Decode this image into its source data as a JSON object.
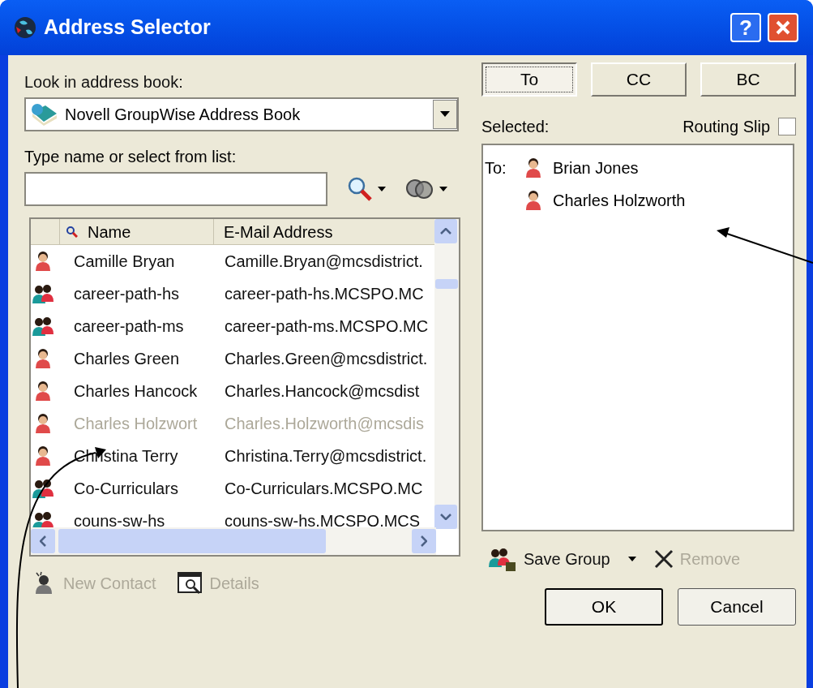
{
  "window": {
    "title": "Address Selector",
    "help_button": "?"
  },
  "address_book": {
    "label": "Look in address book:",
    "value": "Novell GroupWise Address Book"
  },
  "recipient_buttons": [
    {
      "label": "To",
      "selected": true
    },
    {
      "label": "CC",
      "selected": false
    },
    {
      "label": "BC",
      "selected": false
    }
  ],
  "search": {
    "label": "Type name or select from list:"
  },
  "list": {
    "columns": [
      "Name",
      "E-Mail Address"
    ],
    "rows": [
      {
        "kind": "person",
        "name": "Camille Bryan",
        "email": "Camille.Bryan@mcsdistrict.",
        "disabled": false
      },
      {
        "kind": "group",
        "name": "career-path-hs",
        "email": "career-path-hs.MCSPO.MC",
        "disabled": false
      },
      {
        "kind": "group",
        "name": "career-path-ms",
        "email": "career-path-ms.MCSPO.MC",
        "disabled": false
      },
      {
        "kind": "person",
        "name": "Charles Green",
        "email": "Charles.Green@mcsdistrict.",
        "disabled": false
      },
      {
        "kind": "person",
        "name": "Charles Hancock",
        "email": "Charles.Hancock@mcsdist",
        "disabled": false
      },
      {
        "kind": "person",
        "name": "Charles Holzwort",
        "email": "Charles.Holzworth@mcsdis",
        "disabled": true
      },
      {
        "kind": "person",
        "name": "Christina Terry",
        "email": "Christina.Terry@mcsdistrict.",
        "disabled": false
      },
      {
        "kind": "group",
        "name": "Co-Curriculars",
        "email": "Co-Curriculars.MCSPO.MC",
        "disabled": false
      },
      {
        "kind": "group",
        "name": "couns-sw-hs",
        "email": "couns-sw-hs.MCSPO.MCS",
        "disabled": false
      }
    ]
  },
  "selected": {
    "label": "Selected:",
    "routing_slip": {
      "label": "Routing Slip",
      "checked": false
    },
    "recipients": [
      {
        "prefix": "To:",
        "name": "Brian Jones"
      },
      {
        "name": "Charles Holzworth"
      }
    ]
  },
  "actions": [
    {
      "kind": "new",
      "label": "New Contact",
      "disabled": true
    },
    {
      "kind": "details",
      "label": "Details",
      "disabled": true
    }
  ],
  "selected_actions": [
    {
      "kind": "save",
      "label": "Save Group",
      "disabled": false
    },
    {
      "kind": "remove",
      "label": "Remove",
      "disabled": true
    }
  ],
  "buttons": [
    "OK",
    "Cancel"
  ]
}
